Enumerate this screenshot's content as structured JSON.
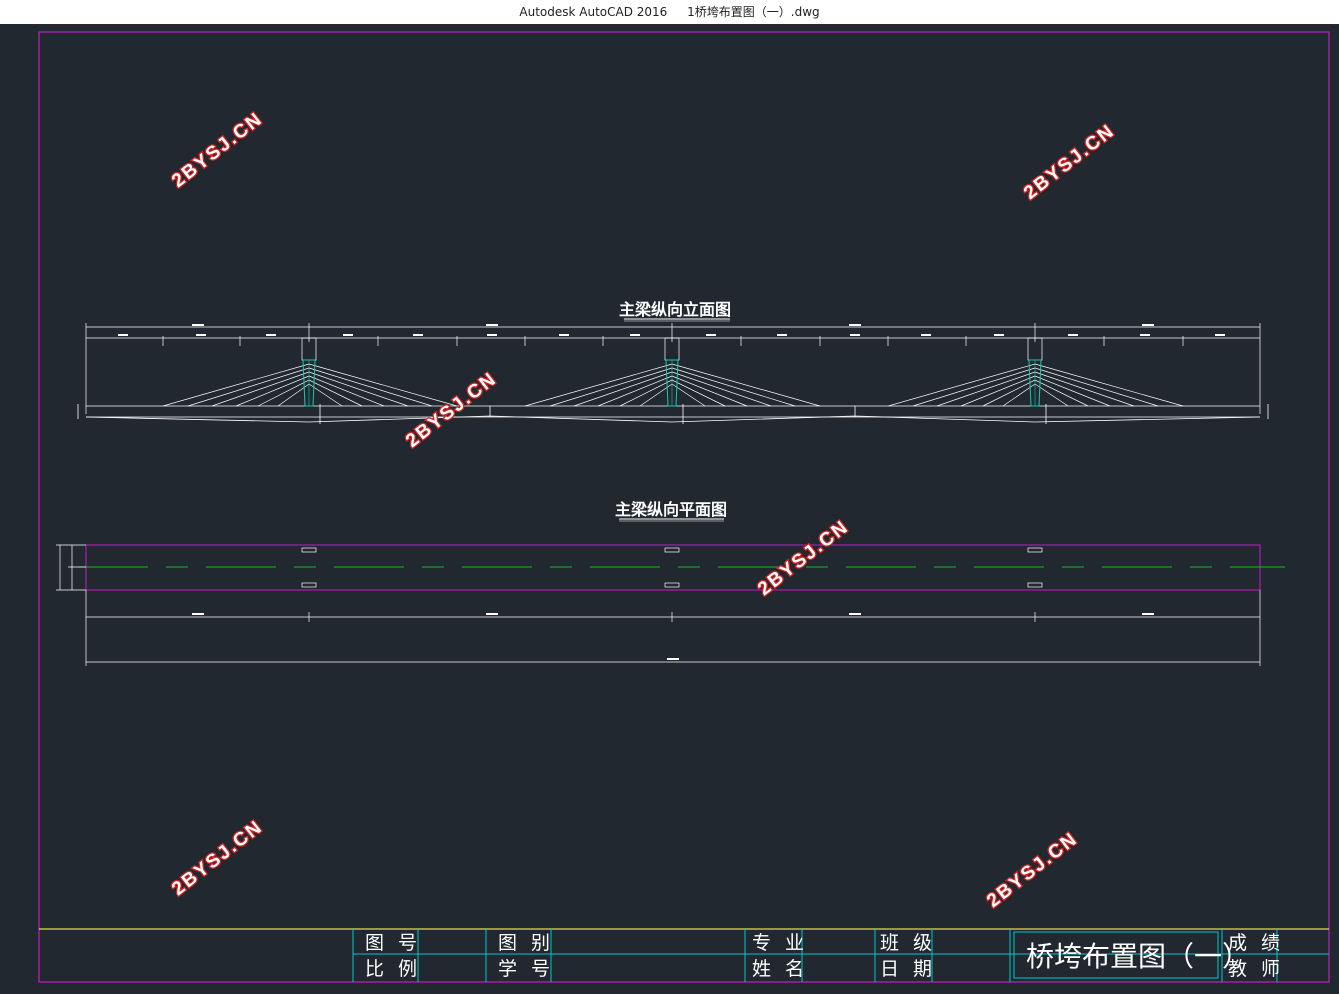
{
  "window": {
    "app_title": "Autodesk AutoCAD 2016",
    "file_name": "1桥垮布置图（一）.dwg"
  },
  "drawing": {
    "elevation_title": "主梁纵向立面图",
    "plan_title": "主梁纵向平面图"
  },
  "watermark": "2BYSJ.CN",
  "title_block": {
    "drawing_no_label": "图 号",
    "scale_label": "比 例",
    "category_label": "图 别",
    "student_no_label": "学 号",
    "major_label": "专 业",
    "name_label": "姓 名",
    "class_label": "班 级",
    "date_label": "日 期",
    "drawing_title": "桥垮布置图（一）",
    "grade_label": "成 绩",
    "teacher_label": "教 师"
  },
  "colors": {
    "background": "#212830",
    "border": "#c020c0",
    "title_block_line": "#00c8c8",
    "title_block_top": "#e0e040",
    "centerline": "#10c010",
    "pylon": "#18c8b0",
    "watermark_stroke": "#d42020"
  }
}
